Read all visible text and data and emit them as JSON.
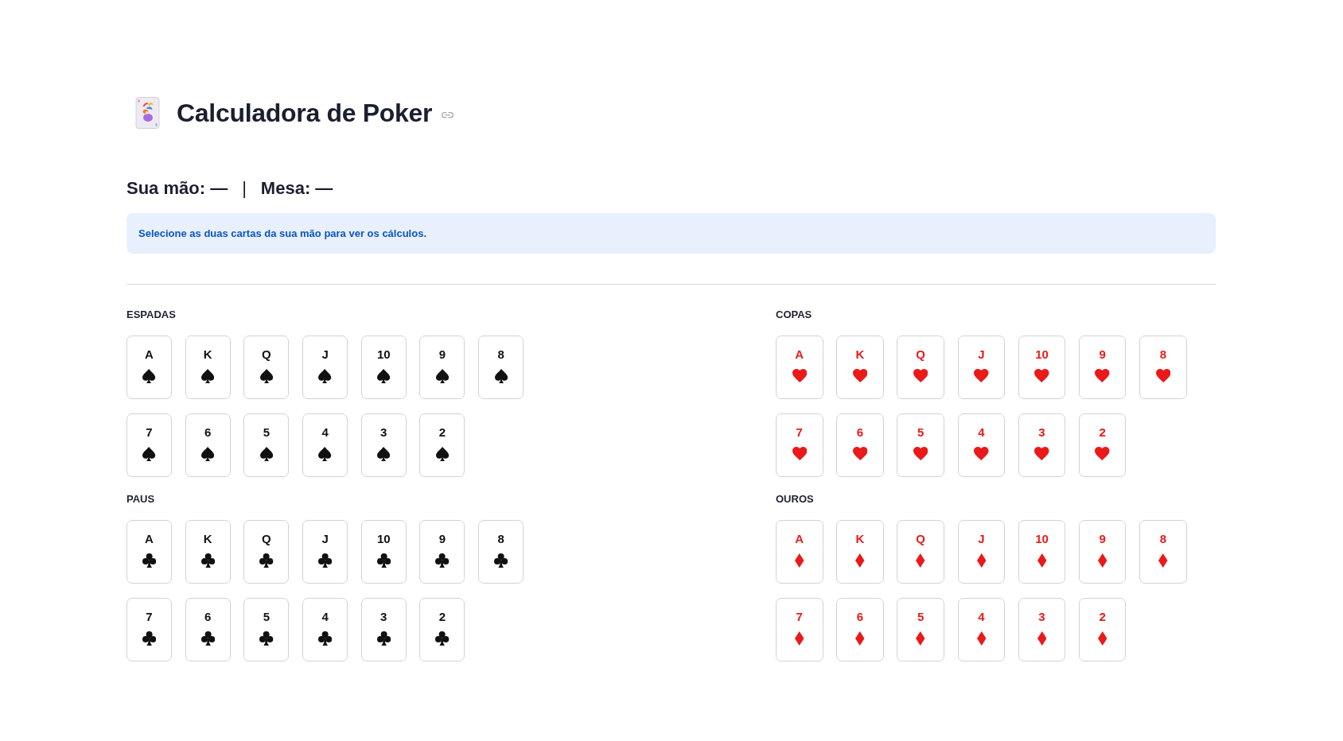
{
  "title": "Calculadora de Poker",
  "summary": {
    "hand": "Sua mão: —",
    "separator": "|",
    "board": "Mesa: —"
  },
  "info": "Selecione as duas cartas da sua mão para ver os cálculos.",
  "suits": [
    {
      "name": "ESPADAS",
      "kind": "spade",
      "color": "#111111",
      "cards": [
        {
          "rank": "A",
          "selected": false
        },
        {
          "rank": "K",
          "selected": false
        },
        {
          "rank": "Q",
          "selected": false
        },
        {
          "rank": "J",
          "selected": false
        },
        {
          "rank": "10",
          "selected": false
        },
        {
          "rank": "9",
          "selected": false
        },
        {
          "rank": "8",
          "selected": false
        },
        {
          "rank": "7",
          "selected": false
        },
        {
          "rank": "6",
          "selected": false
        },
        {
          "rank": "5",
          "selected": false
        },
        {
          "rank": "4",
          "selected": false
        },
        {
          "rank": "3",
          "selected": false
        },
        {
          "rank": "2",
          "selected": false
        }
      ]
    },
    {
      "name": "COPAS",
      "kind": "heart",
      "color": "#ea1a1a",
      "cards": [
        {
          "rank": "A",
          "selected": false
        },
        {
          "rank": "K",
          "selected": false
        },
        {
          "rank": "Q",
          "selected": false
        },
        {
          "rank": "J",
          "selected": false
        },
        {
          "rank": "10",
          "selected": false
        },
        {
          "rank": "9",
          "selected": false
        },
        {
          "rank": "8",
          "selected": false
        },
        {
          "rank": "7",
          "selected": false
        },
        {
          "rank": "6",
          "selected": false
        },
        {
          "rank": "5",
          "selected": false
        },
        {
          "rank": "4",
          "selected": false
        },
        {
          "rank": "3",
          "selected": false
        },
        {
          "rank": "2",
          "selected": false
        }
      ]
    },
    {
      "name": "PAUS",
      "kind": "club",
      "color": "#111111",
      "cards": [
        {
          "rank": "A",
          "selected": false
        },
        {
          "rank": "K",
          "selected": false
        },
        {
          "rank": "Q",
          "selected": false
        },
        {
          "rank": "J",
          "selected": false
        },
        {
          "rank": "10",
          "selected": false
        },
        {
          "rank": "9",
          "selected": false
        },
        {
          "rank": "8",
          "selected": false
        },
        {
          "rank": "7",
          "selected": false
        },
        {
          "rank": "6",
          "selected": false
        },
        {
          "rank": "5",
          "selected": false
        },
        {
          "rank": "4",
          "selected": false
        },
        {
          "rank": "3",
          "selected": false
        },
        {
          "rank": "2",
          "selected": false
        }
      ]
    },
    {
      "name": "OUROS",
      "kind": "diamond",
      "color": "#ea1a1a",
      "cards": [
        {
          "rank": "A",
          "selected": false
        },
        {
          "rank": "K",
          "selected": false
        },
        {
          "rank": "Q",
          "selected": false
        },
        {
          "rank": "J",
          "selected": false
        },
        {
          "rank": "10",
          "selected": false
        },
        {
          "rank": "9",
          "selected": false
        },
        {
          "rank": "8",
          "selected": false
        },
        {
          "rank": "7",
          "selected": false
        },
        {
          "rank": "6",
          "selected": false
        },
        {
          "rank": "5",
          "selected": false
        },
        {
          "rank": "4",
          "selected": false
        },
        {
          "rank": "3",
          "selected": false
        },
        {
          "rank": "2",
          "selected": false
        }
      ]
    }
  ]
}
